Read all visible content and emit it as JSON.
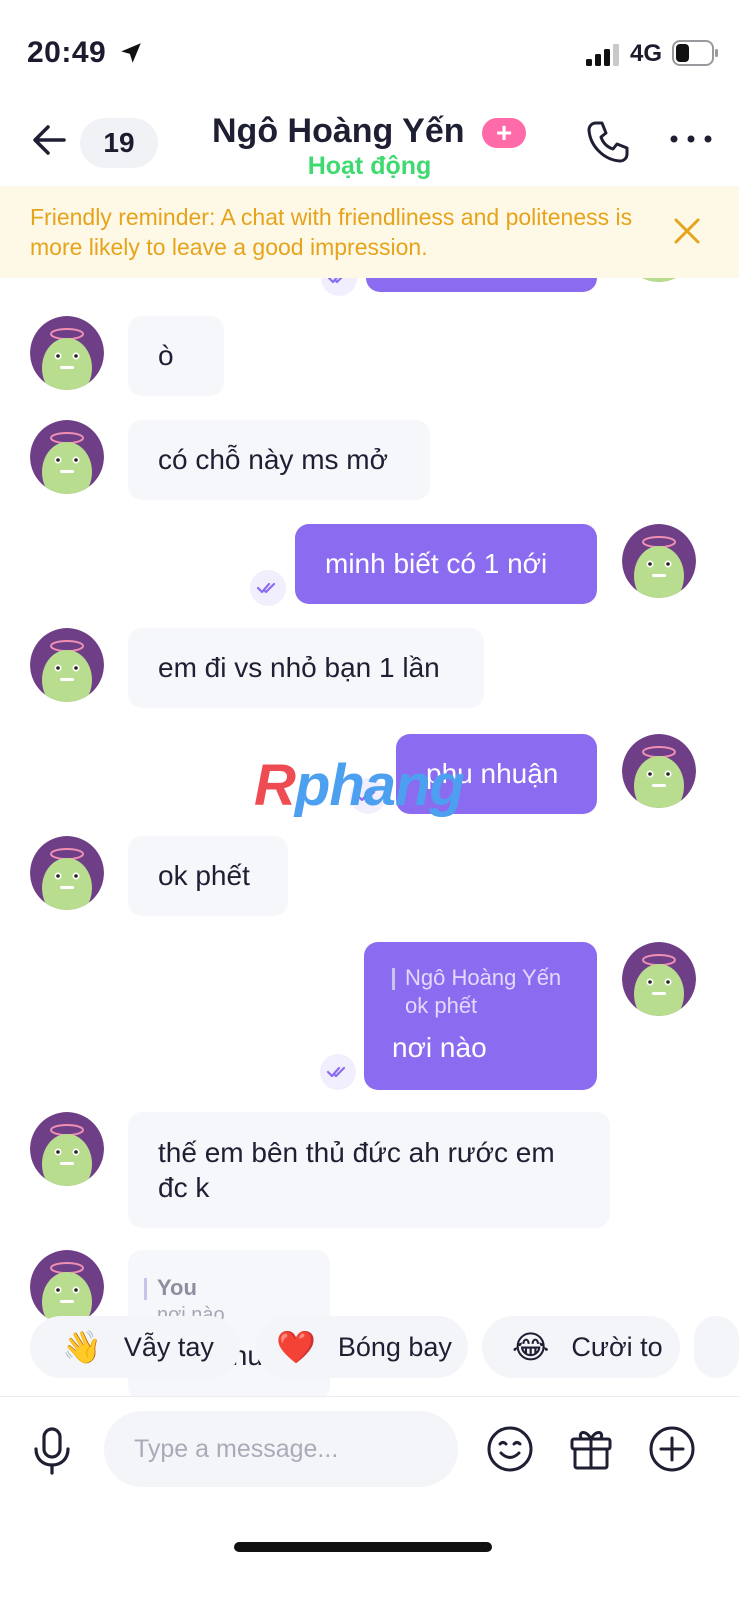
{
  "status_bar": {
    "time": "20:49",
    "network": "4G"
  },
  "header": {
    "unread_count": "19",
    "contact_name": "Ngô Hoàng Yến",
    "badge": "+",
    "status": "Hoạt động"
  },
  "reminder": {
    "text": "Friendly reminder: A chat with friendliness and politeness is more likely to leave a good impression."
  },
  "messages": [
    {
      "side": "in",
      "text": "ò"
    },
    {
      "side": "in",
      "text": "có chỗ này ms mở"
    },
    {
      "side": "out",
      "text": "minh biết có 1  nới"
    },
    {
      "side": "in",
      "text": "em đi vs nhỏ bạn 1 lần"
    },
    {
      "side": "out",
      "text": "phu nhuận"
    },
    {
      "side": "in",
      "text": "ok phết"
    },
    {
      "side": "out",
      "quote_name": "Ngô Hoàng Yến",
      "quote_text": "ok phết",
      "text": "nơi nào"
    },
    {
      "side": "in",
      "text": "thế em bên thủ đức ah rước em đc k"
    },
    {
      "side": "in",
      "quote_name": "You",
      "quote_text": "nơi nào",
      "text": "thu"
    }
  ],
  "watermark": {
    "r": "R",
    "rest": "phang"
  },
  "reactions": [
    {
      "emoji": "👋",
      "label": "Vẫy tay"
    },
    {
      "emoji": "❤️",
      "label": "Bóng bay"
    },
    {
      "emoji": "😂",
      "label": "Cười to"
    }
  ],
  "composer": {
    "placeholder": "Type a message..."
  },
  "colors": {
    "accent": "#8b6cf0",
    "status_green": "#3ed96f",
    "reminder_text": "#e6a31c",
    "reminder_bg": "#fef8e6",
    "badge_pink": "#ff6aa8"
  },
  "icons": [
    "location-arrow-icon",
    "signal-icon",
    "battery-icon",
    "back-arrow-icon",
    "phone-icon",
    "more-dots-icon",
    "close-icon",
    "double-check-icon",
    "microphone-icon",
    "emoji-face-icon",
    "gift-icon",
    "add-circle-icon"
  ]
}
